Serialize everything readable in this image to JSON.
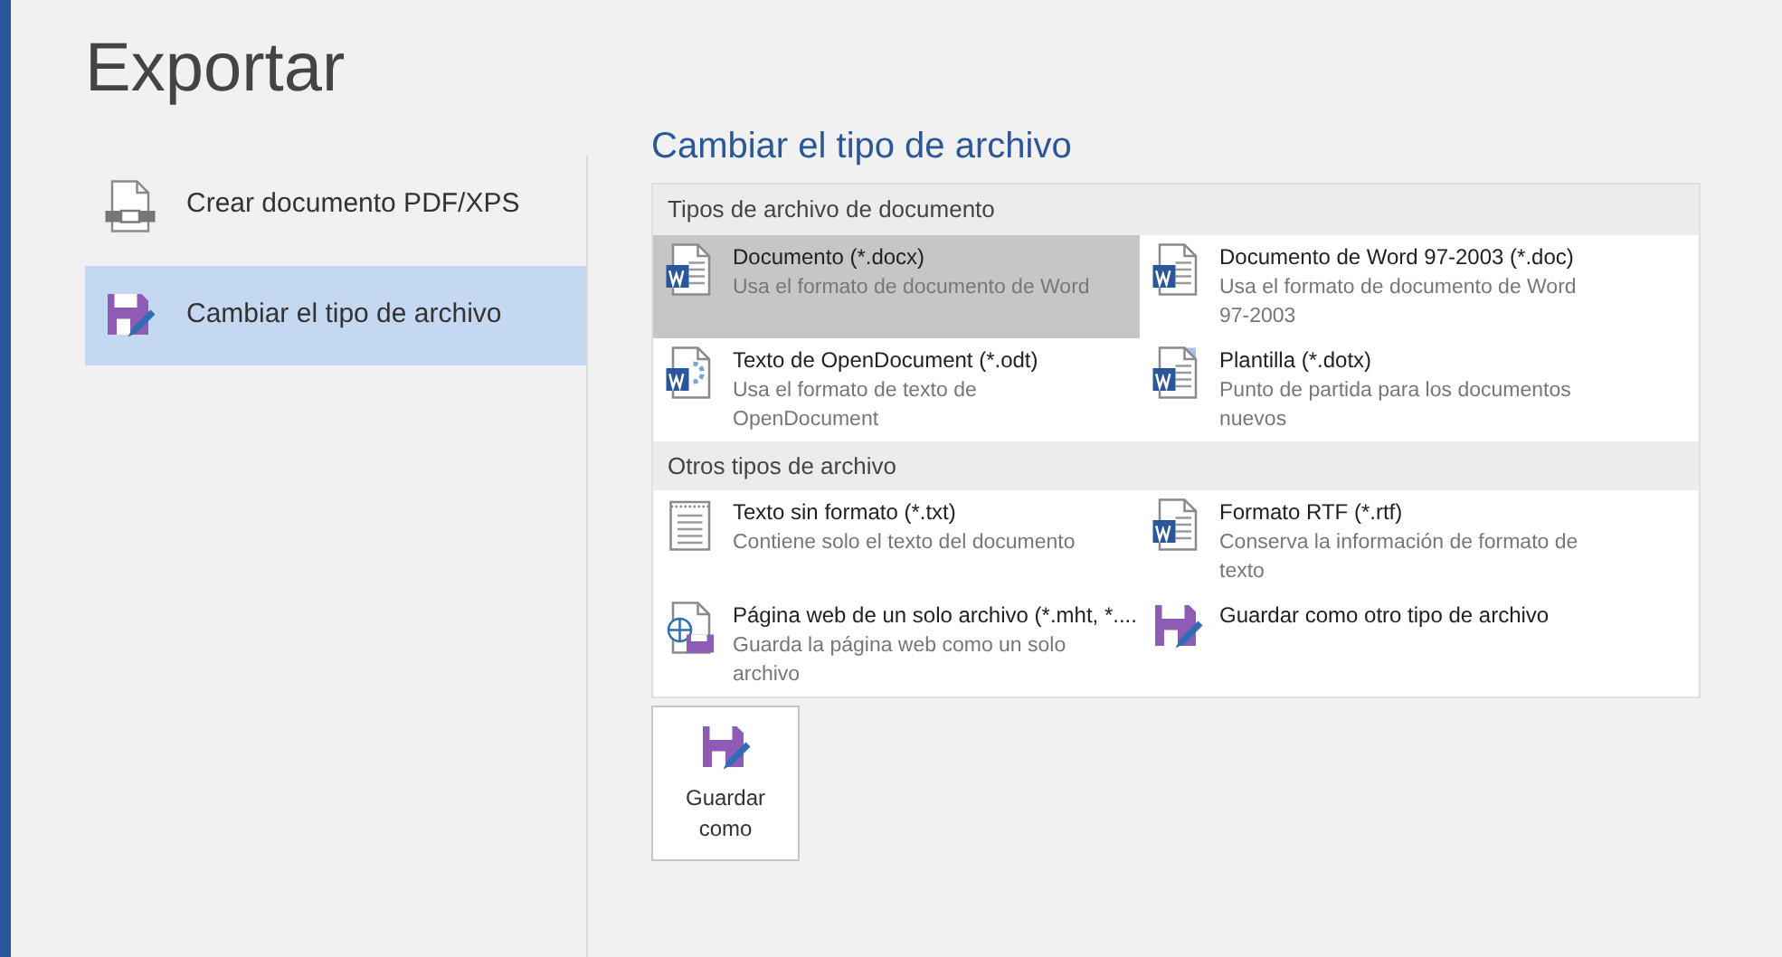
{
  "title": "Exportar",
  "nav": [
    {
      "label": "Crear documento PDF/XPS",
      "kind": "pdf",
      "selected": false
    },
    {
      "label": "Cambiar el tipo de archivo",
      "kind": "save",
      "selected": true
    }
  ],
  "section_title": "Cambiar el tipo de archivo",
  "groups": [
    {
      "heading": "Tipos de archivo de documento",
      "items": [
        {
          "kind": "word",
          "name": "Documento (*.docx)",
          "description": "Usa el formato de documento de Word",
          "selected": true
        },
        {
          "kind": "word-old",
          "name": "Documento de Word 97-2003 (*.doc)",
          "description": "Usa el formato de documento de Word 97-2003",
          "selected": false
        },
        {
          "kind": "odt",
          "name": "Texto de OpenDocument (*.odt)",
          "description": "Usa el formato de texto de OpenDocument",
          "selected": false
        },
        {
          "kind": "template",
          "name": "Plantilla (*.dotx)",
          "description": "Punto de partida para los documentos nuevos",
          "selected": false
        }
      ]
    },
    {
      "heading": "Otros tipos de archivo",
      "items": [
        {
          "kind": "text",
          "name": "Texto sin formato (*.txt)",
          "description": "Contiene solo el texto del documento",
          "selected": false
        },
        {
          "kind": "word-old",
          "name": "Formato RTF (*.rtf)",
          "description": "Conserva la información de formato de texto",
          "selected": false
        },
        {
          "kind": "web",
          "name": "Página web de un solo archivo (*.mht, *....",
          "description": "Guarda la página web como un solo archivo",
          "selected": false
        },
        {
          "kind": "save",
          "name": "Guardar como otro tipo de archivo",
          "selected": false
        }
      ]
    }
  ],
  "save_button": {
    "label": "Guardar como"
  }
}
